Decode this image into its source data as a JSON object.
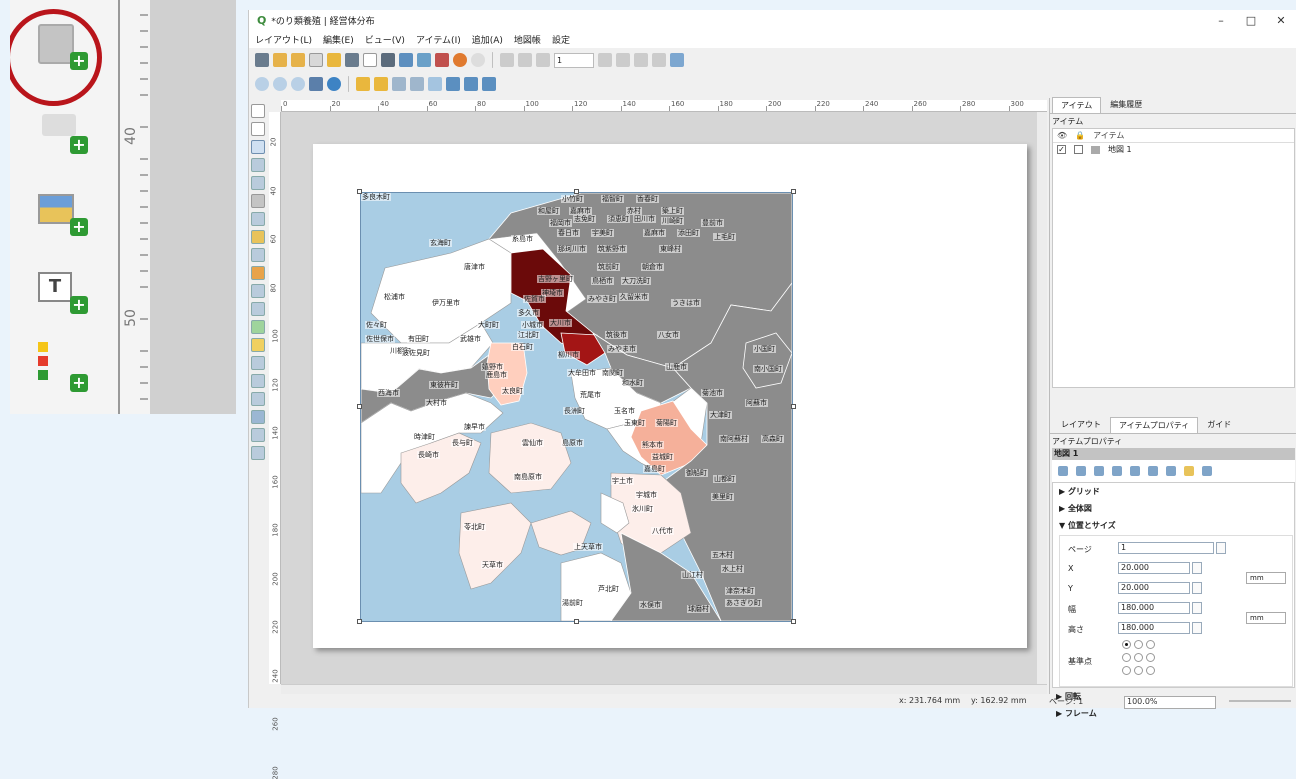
{
  "zoom_panel": {
    "ruler_labels": [
      "40",
      "50"
    ]
  },
  "window": {
    "title": "*のり類養殖 | 経営体分布",
    "controls": [
      "–",
      "□",
      "✕"
    ]
  },
  "menu": [
    "レイアウト(L)",
    "編集(E)",
    "ビュー(V)",
    "アイテム(I)",
    "追加(A)",
    "地図帳",
    "設定"
  ],
  "toolbar": {
    "page_value": "1"
  },
  "ruler_top": [
    "0",
    "20",
    "40",
    "60",
    "80",
    "100",
    "120",
    "140",
    "160",
    "180",
    "200",
    "220",
    "240",
    "260",
    "280",
    "300"
  ],
  "ruler_left": [
    "20",
    "40",
    "60",
    "80",
    "100",
    "120",
    "140",
    "160",
    "180",
    "200",
    "220",
    "240",
    "260",
    "280"
  ],
  "map_labels": [
    {
      "t": "小竹町"
    },
    {
      "t": "福智町"
    },
    {
      "t": "香春町"
    },
    {
      "t": "和屋町"
    },
    {
      "t": "嘉麻市"
    },
    {
      "t": "赤村"
    },
    {
      "t": "築上町"
    },
    {
      "t": "糸島市"
    },
    {
      "t": "福岡市"
    },
    {
      "t": "志免町"
    },
    {
      "t": "須恵町"
    },
    {
      "t": "田川市"
    },
    {
      "t": "川崎町"
    },
    {
      "t": "豊前市"
    },
    {
      "t": "春日市"
    },
    {
      "t": "宇美町"
    },
    {
      "t": "嘉麻市"
    },
    {
      "t": "添田町"
    },
    {
      "t": "上毛町"
    },
    {
      "t": "玄海町"
    },
    {
      "t": "那珂川市"
    },
    {
      "t": "筑紫野市"
    },
    {
      "t": "東峰村"
    },
    {
      "t": "唐津市"
    },
    {
      "t": "吉野ヶ里町"
    },
    {
      "t": "筑前町"
    },
    {
      "t": "朝倉市"
    },
    {
      "t": "神埼市"
    },
    {
      "t": "鳥栖市"
    },
    {
      "t": "大刀洗町"
    },
    {
      "t": "伊万里市"
    },
    {
      "t": "佐賀市"
    },
    {
      "t": "みやき町"
    },
    {
      "t": "久留米市"
    },
    {
      "t": "うきは市"
    },
    {
      "t": "松浦市"
    },
    {
      "t": "多久市"
    },
    {
      "t": "小城市"
    },
    {
      "t": "大川市"
    },
    {
      "t": "佐々町"
    },
    {
      "t": "大町町"
    },
    {
      "t": "江北町"
    },
    {
      "t": "筑後市"
    },
    {
      "t": "八女市"
    },
    {
      "t": "佐世保市"
    },
    {
      "t": "有田町"
    },
    {
      "t": "武雄市"
    },
    {
      "t": "白石町"
    },
    {
      "t": "柳川市"
    },
    {
      "t": "みやま市"
    },
    {
      "t": "小国町"
    },
    {
      "t": "川棚町"
    },
    {
      "t": "波佐見町"
    },
    {
      "t": "嬉野市"
    },
    {
      "t": "大牟田市"
    },
    {
      "t": "南関町"
    },
    {
      "t": "山鹿市"
    },
    {
      "t": "南小国町"
    },
    {
      "t": "鹿島市"
    },
    {
      "t": "和水町"
    },
    {
      "t": "菊池市"
    },
    {
      "t": "西海市"
    },
    {
      "t": "東彼杵町"
    },
    {
      "t": "太良町"
    },
    {
      "t": "荒尾市"
    },
    {
      "t": "阿蘇市"
    },
    {
      "t": "大村市"
    },
    {
      "t": "長洲町"
    },
    {
      "t": "玉名市"
    },
    {
      "t": "大津町"
    },
    {
      "t": "諫早市"
    },
    {
      "t": "玉東町"
    },
    {
      "t": "菊陽町"
    },
    {
      "t": "時津町"
    },
    {
      "t": "長与町"
    },
    {
      "t": "雲仙市"
    },
    {
      "t": "島原市"
    },
    {
      "t": "熊本市"
    },
    {
      "t": "南阿蘇村"
    },
    {
      "t": "高森町"
    },
    {
      "t": "長崎市"
    },
    {
      "t": "益城町"
    },
    {
      "t": "嘉島町"
    },
    {
      "t": "御船町"
    },
    {
      "t": "南島原市"
    },
    {
      "t": "宇土市"
    },
    {
      "t": "山都町"
    },
    {
      "t": "宇城市"
    },
    {
      "t": "美里町"
    },
    {
      "t": "氷川町"
    },
    {
      "t": "苓北町"
    },
    {
      "t": "八代市"
    },
    {
      "t": "上天草市"
    },
    {
      "t": "五木村"
    },
    {
      "t": "天草市"
    },
    {
      "t": "山江村"
    },
    {
      "t": "水上村"
    },
    {
      "t": "芦北町"
    },
    {
      "t": "津奈木町"
    },
    {
      "t": "湯前町"
    },
    {
      "t": "水俣市"
    },
    {
      "t": "球磨村"
    },
    {
      "t": "あさぎり町"
    },
    {
      "t": "多良木町"
    }
  ],
  "right_panel": {
    "tabs": [
      "アイテム",
      "編集履歴"
    ],
    "items_title": "アイテム",
    "items_header": "アイテム",
    "items": [
      {
        "name": "地図 1",
        "checked": "✓"
      }
    ],
    "lower_tabs": [
      "レイアウト",
      "アイテムプロパティ",
      "ガイド"
    ],
    "props_title": "アイテムプロパティ",
    "item_name": "地図 1",
    "sections": [
      "グリッド",
      "全体図",
      "位置とサイズ",
      "回転",
      "フレーム"
    ],
    "fields": {
      "page_label": "ページ",
      "page": "1",
      "x_label": "X",
      "x": "20.000",
      "y_label": "Y",
      "y": "20.000",
      "w_label": "幅",
      "w": "180.000",
      "h_label": "高さ",
      "h": "180.000",
      "unit": "mm",
      "ref_label": "基準点"
    }
  },
  "status": {
    "x": "x: 231.764 mm",
    "y": "y: 162.92 mm",
    "page": "ページ: 1",
    "zoom": "100.0%"
  }
}
